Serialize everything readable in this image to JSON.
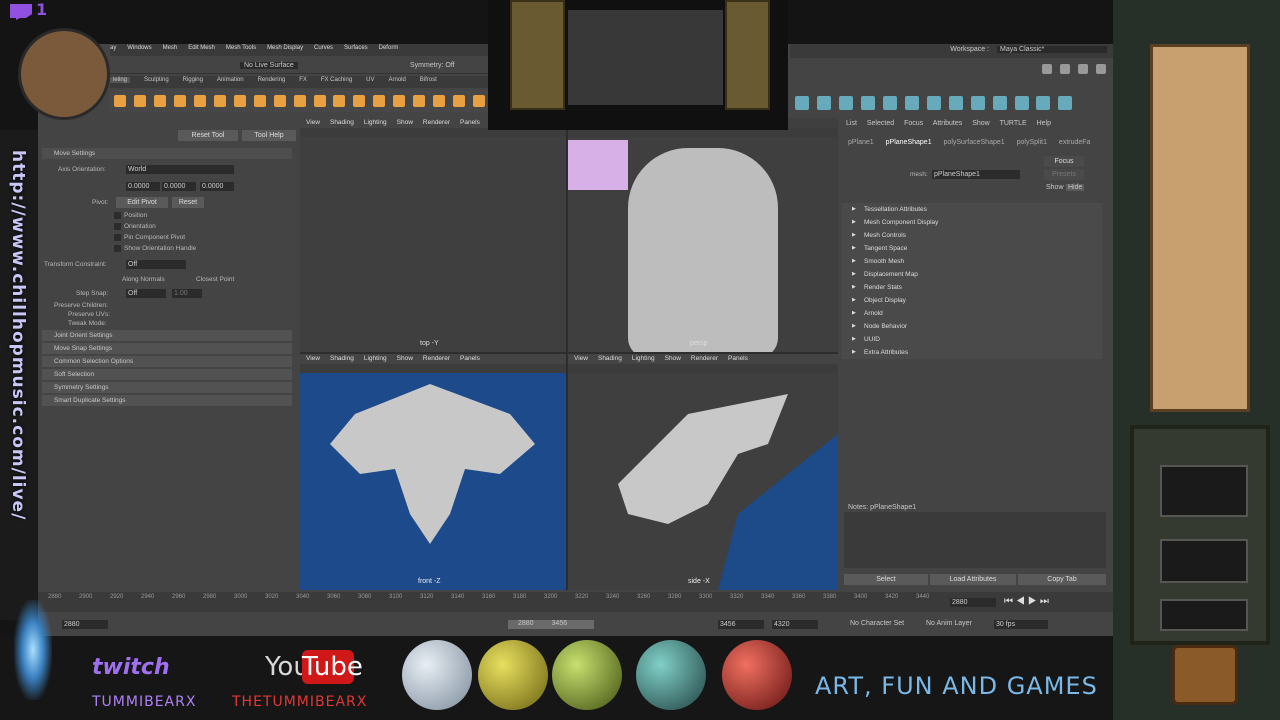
{
  "overlay": {
    "twitch_count": "1",
    "url": "http://www.chillhopmusic.com/live/",
    "twitch_label": "twitch",
    "twitch_name": "TUMMIBEARX",
    "youtube_you": "You",
    "youtube_tube": "Tube",
    "youtube_name": "THETUMMIBEARX",
    "tagline": "ART, FUN AND GAMES"
  },
  "maya": {
    "menubar": [
      "ay",
      "Windows",
      "Mesh",
      "Edit Mesh",
      "Mesh Tools",
      "Mesh Display",
      "Curves",
      "Surfaces",
      "Deform"
    ],
    "workspace_label": "Workspace :",
    "workspace_value": "Maya Classic*",
    "status": {
      "live_surface": "No Live Surface",
      "symmetry": "Symmetry: Off"
    },
    "shelf_tabs": [
      "leling",
      "Sculpting",
      "Rigging",
      "Animation",
      "Rendering",
      "FX",
      "FX Caching",
      "UV",
      "Arnold",
      "Bifrost",
      "Bo"
    ],
    "tool": {
      "reset": "Reset Tool",
      "help": "Tool Help",
      "move_settings": "Move Settings",
      "axis_orientation_label": "Axis Orientation:",
      "axis_orientation_value": "World",
      "xyz": [
        "0.0000",
        "0.0000",
        "0.0000"
      ],
      "pivot_label": "Pivot:",
      "edit_pivot": "Edit Pivot",
      "pivot_reset": "Reset",
      "pivot_checks": [
        "Position",
        "Orientation",
        "Pin Component Pivot",
        "Show Orientation Handle"
      ],
      "transform_constraint_label": "Transform Constraint:",
      "transform_constraint_value": "Off",
      "along_normals": "Along Normals",
      "closest_point": "Closest Point",
      "step_snap_label": "Step Snap:",
      "step_snap_value": "Off",
      "step_snap_num": "1.00",
      "preserve_children": "Preserve Children:",
      "preserve_uvs": "Preserve UVs:",
      "tweak_mode": "Tweak Mode:",
      "sections": [
        "Joint Orient Settings",
        "Move Snap Settings",
        "Common Selection Options",
        "Soft Selection",
        "Symmetry Settings",
        "Smart Duplicate Settings"
      ]
    },
    "viewport_menu": [
      "View",
      "Shading",
      "Lighting",
      "Show",
      "Renderer",
      "Panels"
    ],
    "viewport_labels": {
      "top": "top -Y",
      "persp": "persp",
      "front": "front -Z",
      "side": "side -X"
    },
    "attr": {
      "menu": [
        "List",
        "Selected",
        "Focus",
        "Attributes",
        "Show",
        "TURTLE",
        "Help"
      ],
      "tabs": [
        "pPlane1",
        "pPlaneShape1",
        "polySurfaceShape1",
        "polySplit1",
        "extrudeFa"
      ],
      "focus": "Focus",
      "presets": "Presets",
      "show": "Show",
      "hide": "Hide",
      "mesh_label": "mesh:",
      "mesh_value": "pPlaneShape1",
      "sections": [
        "Tessellation Attributes",
        "Mesh Component Display",
        "Mesh Controls",
        "Tangent Space",
        "Smooth Mesh",
        "Displacement Map",
        "Render Stats",
        "Object Display",
        "Arnold",
        "Node Behavior",
        "UUID",
        "Extra Attributes"
      ],
      "notes": "Notes: pPlaneShape1",
      "select": "Select",
      "load": "Load Attributes",
      "copy": "Copy Tab"
    },
    "timeline": {
      "ticks": [
        "2880",
        "2900",
        "2920",
        "2940",
        "2960",
        "2980",
        "3000",
        "3020",
        "3040",
        "3060",
        "3080",
        "3100",
        "3120",
        "3140",
        "3160",
        "3180",
        "3200",
        "3220",
        "3240",
        "3260",
        "3280",
        "3300",
        "3320",
        "3340",
        "3360",
        "3380",
        "3400",
        "3420",
        "3440"
      ],
      "current": "2880",
      "range_start": "2880",
      "range_mid_a": "2880",
      "range_mid_b": "3456",
      "range_end_a": "3456",
      "range_end_b": "4320",
      "character_set": "No Character Set",
      "anim_layer": "No Anim Layer",
      "fps": "30 fps"
    }
  }
}
